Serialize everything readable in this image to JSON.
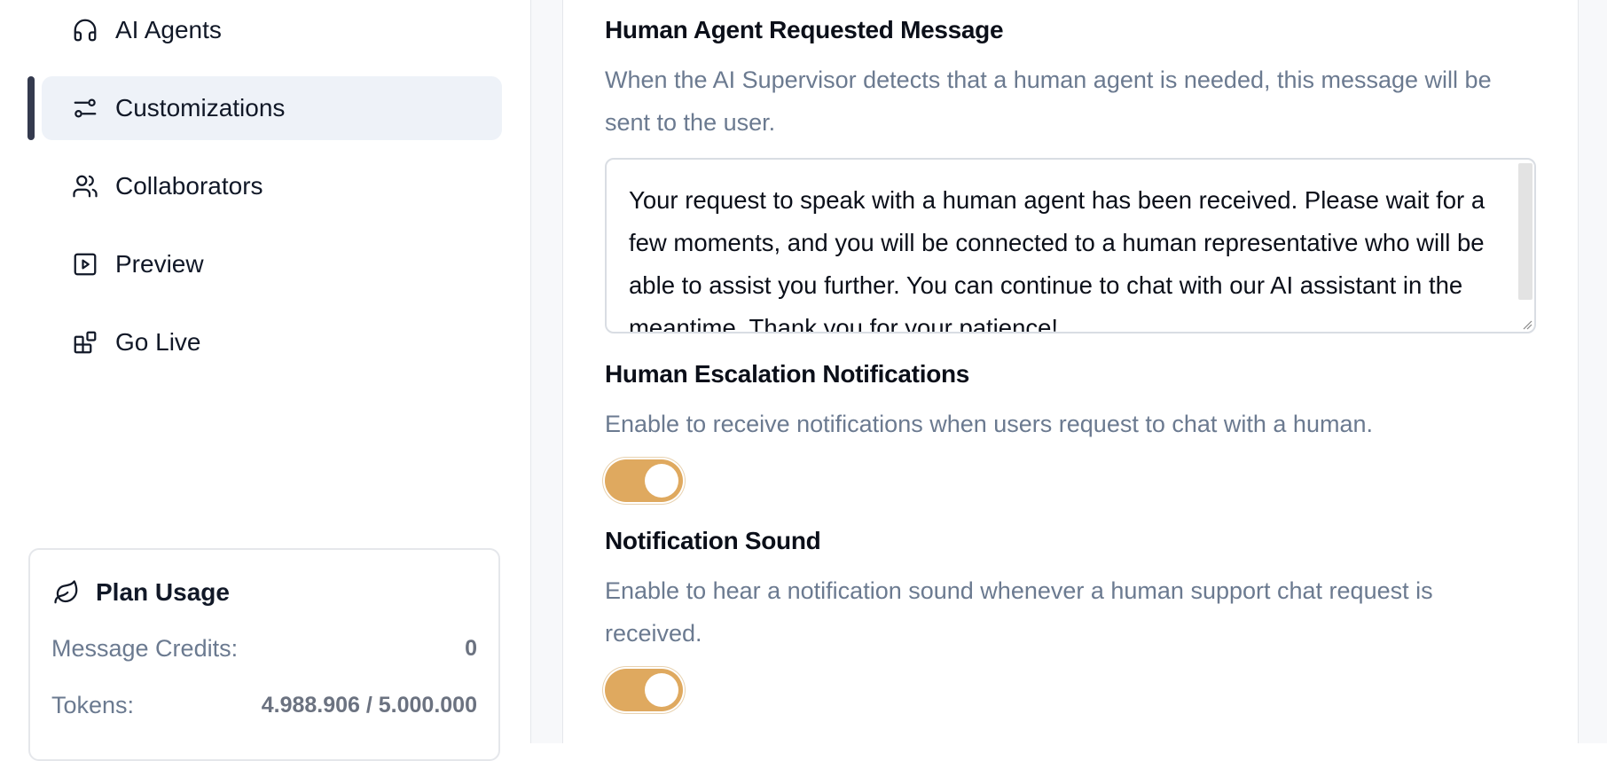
{
  "sidebar": {
    "items": [
      {
        "label": "AI Agents",
        "icon": "headphones-icon"
      },
      {
        "label": "Customizations",
        "icon": "sliders-icon",
        "active": true
      },
      {
        "label": "Collaborators",
        "icon": "users-icon"
      },
      {
        "label": "Preview",
        "icon": "play-square-icon"
      },
      {
        "label": "Go Live",
        "icon": "blocks-icon"
      }
    ]
  },
  "plan_usage": {
    "title": "Plan Usage",
    "icon": "leaf-icon",
    "message_credits_label": "Message Credits:",
    "message_credits_value": "0",
    "tokens_label": "Tokens:",
    "tokens_value": "4.988.906 / 5.000.000"
  },
  "settings": {
    "human_agent_message": {
      "title": "Human Agent Requested Message",
      "description": "When the AI Supervisor detects that a human agent is needed, this message will be sent to the user.",
      "value": "Your request to speak with a human agent has been received. Please wait for a few moments, and you will be connected to a human representative who will be able to assist you further. You can continue to chat with our AI assistant in the meantime. Thank you for your patience!"
    },
    "escalation_notifications": {
      "title": "Human Escalation Notifications",
      "description": "Enable to receive notifications when users request to chat with a human.",
      "enabled": true
    },
    "notification_sound": {
      "title": "Notification Sound",
      "description": "Enable to hear a notification sound whenever a human support chat request is received.",
      "enabled": true
    }
  },
  "colors": {
    "accent": "#dfa95f",
    "active_bar": "#343a4e",
    "active_bg": "#eef2f8",
    "muted_text": "#6b7a90"
  }
}
